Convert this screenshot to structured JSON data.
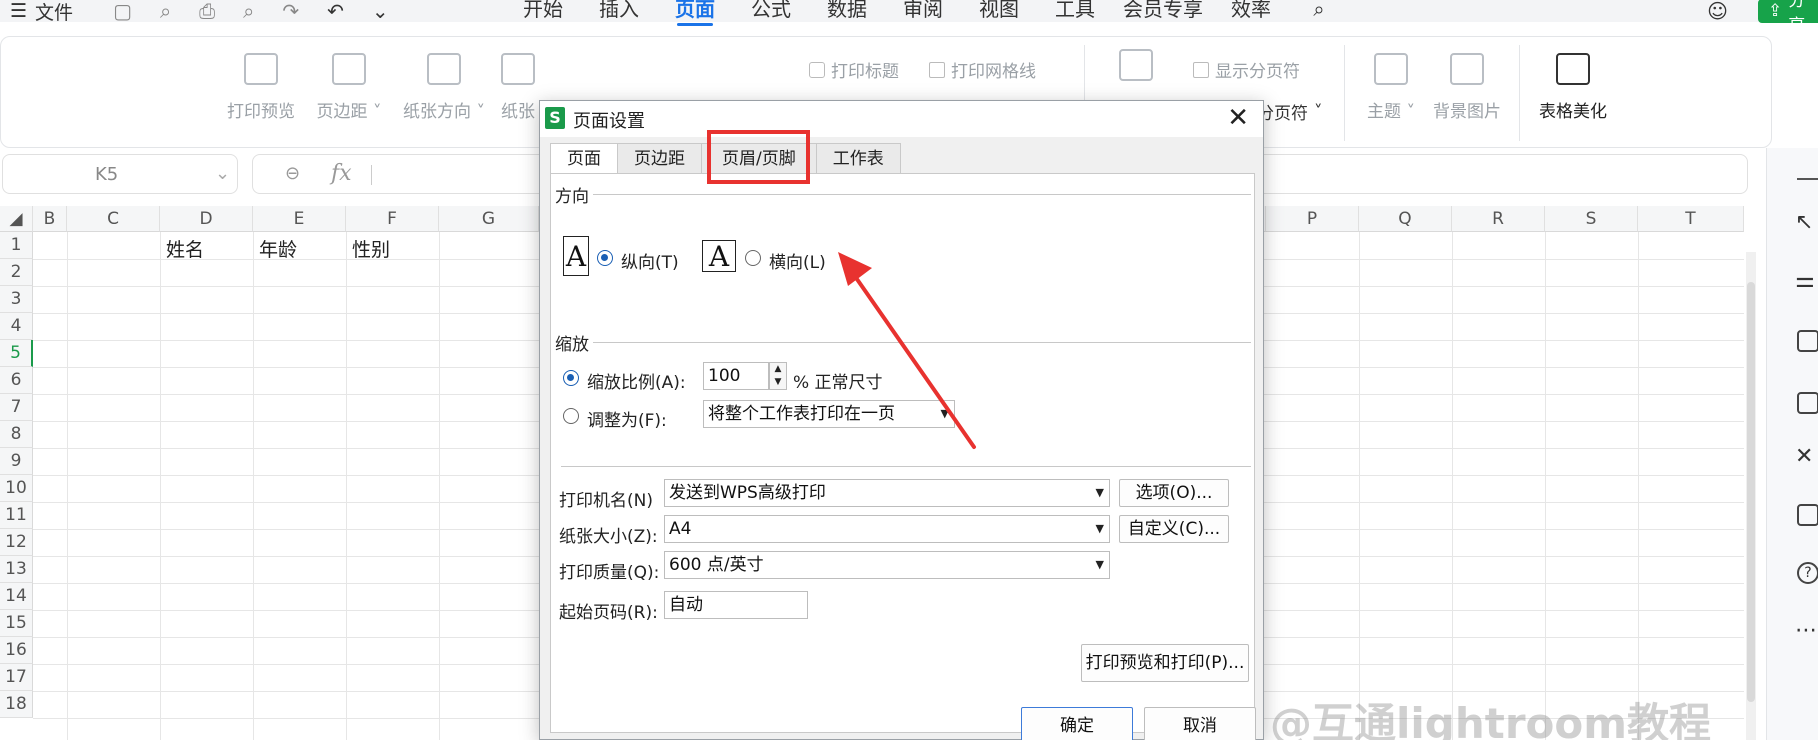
{
  "menubar": {
    "file_label": "文件",
    "tabs": [
      "开始",
      "插入",
      "页面",
      "公式",
      "数据",
      "审阅",
      "视图",
      "工具",
      "会员专享",
      "效率"
    ],
    "share_label": "分享"
  },
  "ribbon": {
    "print_preview": "打印预览",
    "margins": "页边距",
    "orientation": "纸张方向",
    "paper_size_partial": "纸张",
    "print_titles": "打印标题",
    "print_gridlines": "打印网格线",
    "show_page_breaks": "显示分页符",
    "page_break": "分页符",
    "theme": "主题",
    "background_image": "背景图片",
    "table_beautify": "表格美化"
  },
  "formula_bar": {
    "name_box": "K5",
    "fx": "fx"
  },
  "grid": {
    "columns_left": [
      "B",
      "C",
      "D",
      "E",
      "F",
      "G"
    ],
    "columns_right": [
      "P",
      "Q",
      "R",
      "S",
      "T"
    ],
    "rows": [
      "1",
      "2",
      "3",
      "4",
      "5",
      "6",
      "7",
      "8",
      "9",
      "10",
      "11",
      "12",
      "13",
      "14",
      "15",
      "16",
      "17",
      "18"
    ],
    "row1_values": [
      "姓名",
      "年龄",
      "性别"
    ]
  },
  "dialog": {
    "title": "页面设置",
    "logo": "S",
    "tabs": [
      "页面",
      "页边距",
      "页眉/页脚",
      "工作表"
    ],
    "orientation_label": "方向",
    "portrait_label": "纵向(T)",
    "landscape_label": "横向(L)",
    "scale_label": "缩放",
    "scale_ratio_label": "缩放比例(A):",
    "scale_value": "100",
    "scale_suffix": "% 正常尺寸",
    "fit_label": "调整为(F):",
    "fit_value": "将整个工作表打印在一页",
    "printer_label": "打印机名(N)",
    "printer_value": "发送到WPS高级打印",
    "options_btn": "选项(O)...",
    "paper_label": "纸张大小(Z):",
    "paper_value": "A4",
    "custom_btn": "自定义(C)...",
    "quality_label": "打印质量(Q):",
    "quality_value": "600 点/英寸",
    "start_page_label": "起始页码(R):",
    "start_page_value": "自动",
    "preview_print_btn": "打印预览和打印(P)...",
    "ok_btn": "确定",
    "cancel_btn": "取消"
  },
  "watermark": "@互通lightroom教程",
  "colors": {
    "accent": "#1a73e8",
    "highlight": "#e8322f",
    "wps_green": "#1a9a4a"
  }
}
